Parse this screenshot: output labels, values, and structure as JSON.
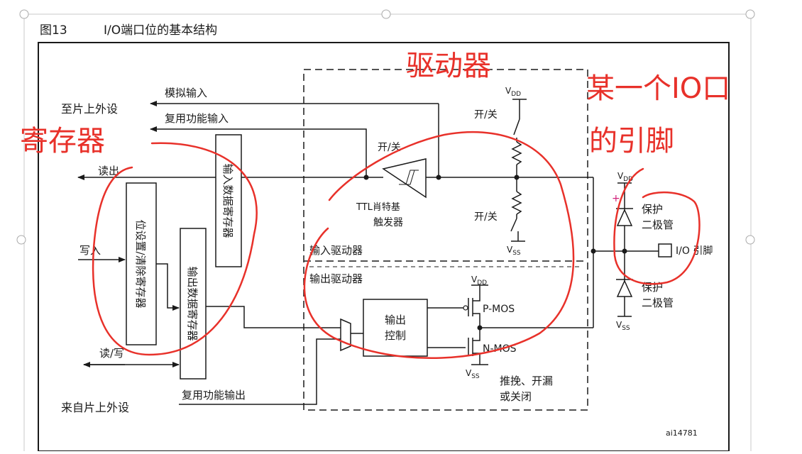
{
  "figure": {
    "number": "图13",
    "title": "I/O端口位的基本结构",
    "ref_code": "ai14781"
  },
  "labels": {
    "to_peripheral": "至片上外设",
    "from_peripheral": "来自片上外设",
    "analog_input": "模拟输入",
    "af_input": "复用功能输入",
    "af_output": "复用功能输出",
    "read_out": "读出",
    "write_in": "写入",
    "read_write": "读/写",
    "bsrr": "位设置/清除寄存器",
    "odr": "输出数据寄存器",
    "idr": "输入数据寄存器",
    "on_off": "开/关",
    "ttl_line1": "TTL肖特基",
    "ttl_line2": "触发器",
    "input_driver": "输入驱动器",
    "output_driver": "输出驱动器",
    "output_ctrl_line1": "输出",
    "output_ctrl_line2": "控制",
    "pmos": "P-MOS",
    "nmos": "N-MOS",
    "push_pull_line1": "推挽、开漏",
    "push_pull_line2": "或关闭",
    "protect_line1": "保护",
    "protect_line2": "二极管",
    "io_pin": "I/O 引脚",
    "vdd_main": "V",
    "vdd_sub": "DD",
    "vss_main": "V",
    "vss_sub": "SS"
  },
  "annotations": {
    "registers": "寄存器",
    "driver": "驱动器",
    "io_pin_line1": "某一个IO口",
    "io_pin_line2": "的引脚"
  },
  "colors": {
    "ink": "#1a1a1a",
    "annotation": "#e8312a",
    "frame": "#c8c8c8",
    "plus_mark": "#d0207a"
  }
}
